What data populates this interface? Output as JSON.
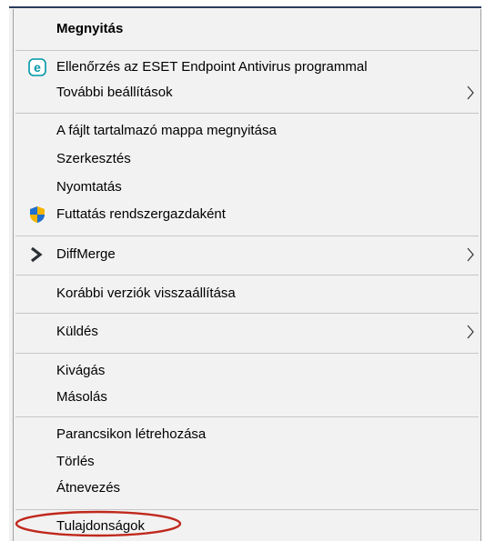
{
  "menu": {
    "open": "Megnyitás",
    "eset_scan": "Ellenőrzés az ESET Endpoint Antivirus programmal",
    "more_settings": "További beállítások",
    "open_folder": "A fájlt tartalmazó mappa megnyitása",
    "edit": "Szerkesztés",
    "print": "Nyomtatás",
    "run_as_admin": "Futtatás rendszergazdaként",
    "diffmerge": "DiffMerge",
    "restore_versions": "Korábbi verziók visszaállítása",
    "send_to": "Küldés",
    "cut": "Kivágás",
    "copy": "Másolás",
    "create_shortcut": "Parancsikon létrehozása",
    "delete": "Törlés",
    "rename": "Átnevezés",
    "properties": "Tulajdonságok"
  },
  "icons": {
    "eset": "eset-e-icon",
    "uac_shield": "uac-shield-icon",
    "diffmerge": "diffmerge-arrow-icon",
    "submenu": "chevron-right-icon"
  },
  "colors": {
    "menu_bg": "#f2f2f2",
    "separator": "#c6c6c6",
    "eset_accent": "#0097a7",
    "highlight_ellipse": "#c0281c"
  }
}
